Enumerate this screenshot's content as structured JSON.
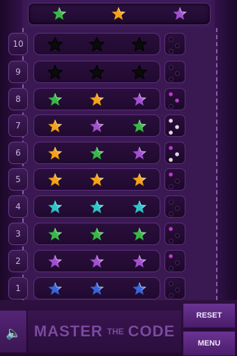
{
  "code_bar": {
    "stars": [
      {
        "color": "#39b84a",
        "state": "green"
      },
      {
        "color": "#f5a11a",
        "state": "orange"
      },
      {
        "color": "#a24fd0",
        "state": "purple"
      }
    ]
  },
  "rows": [
    {
      "number": "10",
      "stars": [
        "empty",
        "empty",
        "empty"
      ],
      "hints": [
        "empty",
        "empty",
        "empty"
      ]
    },
    {
      "number": "9",
      "stars": [
        "empty",
        "empty",
        "empty"
      ],
      "hints": [
        "empty",
        "empty",
        "empty"
      ]
    },
    {
      "number": "8",
      "stars": [
        "green",
        "orange",
        "purple"
      ],
      "hints": [
        "magenta",
        "magenta",
        "empty"
      ]
    },
    {
      "number": "7",
      "stars": [
        "orange",
        "purple",
        "green"
      ],
      "hints": [
        "white",
        "white",
        "white"
      ]
    },
    {
      "number": "6",
      "stars": [
        "orange",
        "green",
        "purple"
      ],
      "hints": [
        "magenta",
        "white",
        "white"
      ]
    },
    {
      "number": "5",
      "stars": [
        "orange",
        "orange",
        "orange"
      ],
      "hints": [
        "magenta",
        "empty",
        "empty"
      ]
    },
    {
      "number": "4",
      "stars": [
        "cyan",
        "cyan",
        "cyan"
      ],
      "hints": [
        "empty",
        "empty",
        "empty"
      ]
    },
    {
      "number": "3",
      "stars": [
        "green",
        "green",
        "green"
      ],
      "hints": [
        "magenta",
        "empty",
        "empty"
      ]
    },
    {
      "number": "2",
      "stars": [
        "purple",
        "purple",
        "purple"
      ],
      "hints": [
        "magenta",
        "empty",
        "empty"
      ]
    },
    {
      "number": "1",
      "stars": [
        "blue",
        "blue",
        "blue"
      ],
      "hints": [
        "empty",
        "empty",
        "empty"
      ]
    }
  ],
  "colors": {
    "green": "#39b84a",
    "orange": "#f5a11a",
    "purple": "#a24fd0",
    "cyan": "#2fc3c9",
    "blue": "#3c63d8",
    "empty": "#121012",
    "magenta": "#c13ad6",
    "white": "#e7d9ef",
    "hint_empty": "#1a0826"
  },
  "footer": {
    "title_master": "MASTER",
    "title_the": "THE",
    "title_code": "CODE",
    "reset_label": "RESET",
    "menu_label": "MENU",
    "sound_icon": "speaker-icon"
  }
}
